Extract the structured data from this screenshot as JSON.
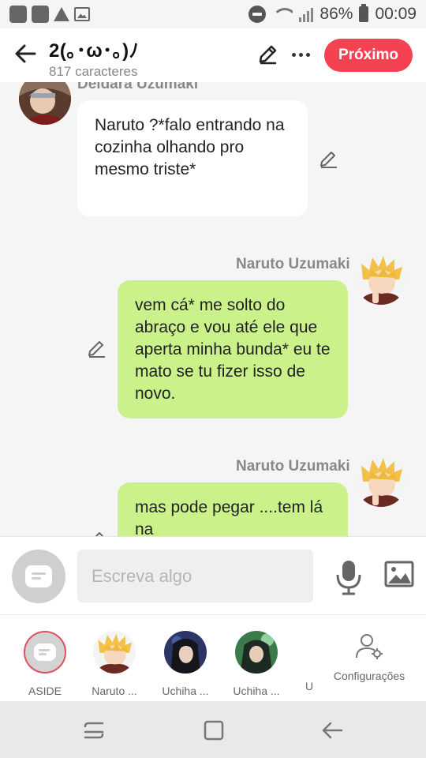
{
  "status_bar": {
    "battery": "86%",
    "time": "00:09"
  },
  "header": {
    "title": "2(｡･ω･｡)ﾉ",
    "subtitle": "817 caracteres",
    "next_label": "Próximo"
  },
  "messages": [
    {
      "sender": "Deidara Uzumaki",
      "text": "Naruto ?*falo entrando na cozinha olhando pro mesmo triste*",
      "side": "left"
    },
    {
      "sender": "Naruto Uzumaki",
      "text": "vem cá* me solto do abraço e vou até ele que aperta minha bunda* eu te mato se tu fizer isso de novo.",
      "side": "right"
    },
    {
      "sender": "Naruto Uzumaki",
      "text": "mas pode pegar ....tem lá na",
      "side": "right"
    }
  ],
  "composer": {
    "placeholder": "Escreva algo"
  },
  "characters": [
    {
      "name": "ASIDE"
    },
    {
      "name": "Naruto ..."
    },
    {
      "name": "Uchiha ..."
    },
    {
      "name": "Uchiha ..."
    },
    {
      "name": "U"
    }
  ],
  "settings_label": "Configurações",
  "colors": {
    "accent": "#f44253",
    "bubble_green": "#cbf18a"
  }
}
